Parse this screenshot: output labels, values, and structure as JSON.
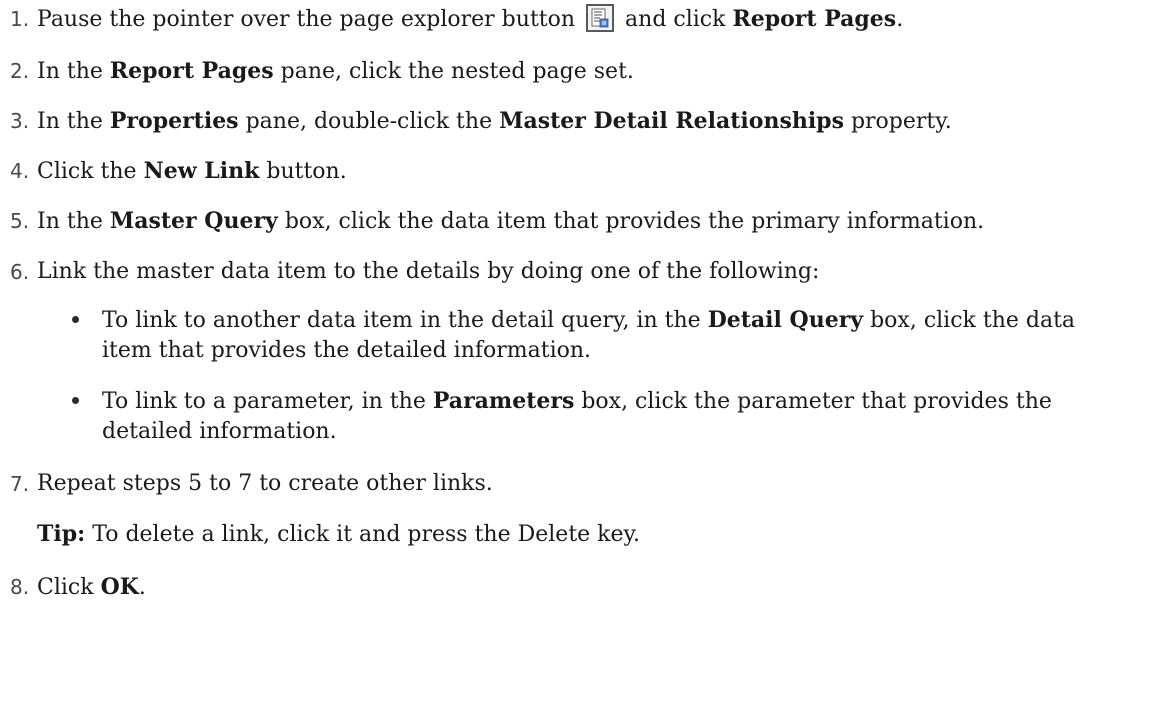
{
  "steps": [
    {
      "num": "1.",
      "parts": [
        "Pause the pointer over the page explorer button",
        "and click",
        "Report Pages",
        "."
      ]
    },
    {
      "num": "2.",
      "parts": [
        "In the",
        "Report Pages",
        "pane, click the nested page set."
      ]
    },
    {
      "num": "3.",
      "parts": [
        "In the",
        "Properties",
        "pane, double-click the",
        "Master Detail Relationships",
        "property."
      ]
    },
    {
      "num": "4.",
      "parts": [
        "Click the",
        "New Link",
        "button."
      ]
    },
    {
      "num": "5.",
      "parts": [
        "In the",
        "Master Query",
        "box, click the data item that provides the primary information."
      ]
    },
    {
      "num": "6.",
      "parts": [
        "Link the master data item to the details by doing one of the following:"
      ]
    },
    {
      "num": "7.",
      "parts": [
        "Repeat steps 5 to 7 to create other links."
      ]
    },
    {
      "num": "8.",
      "parts": [
        "Click",
        "OK",
        "."
      ]
    }
  ],
  "bullets": [
    {
      "parts": [
        "To link to another data item in the detail query, in the",
        "Detail Query",
        "box, click the data item that provides the detailed information."
      ]
    },
    {
      "parts": [
        "To link to a parameter, in the",
        "Parameters",
        "box, click the parameter that provides the detailed information."
      ]
    }
  ],
  "tip": {
    "label": "Tip:",
    "text": "To delete a link, click it and press the Delete key."
  },
  "icons": {
    "page_explorer": "page-explorer-icon"
  }
}
